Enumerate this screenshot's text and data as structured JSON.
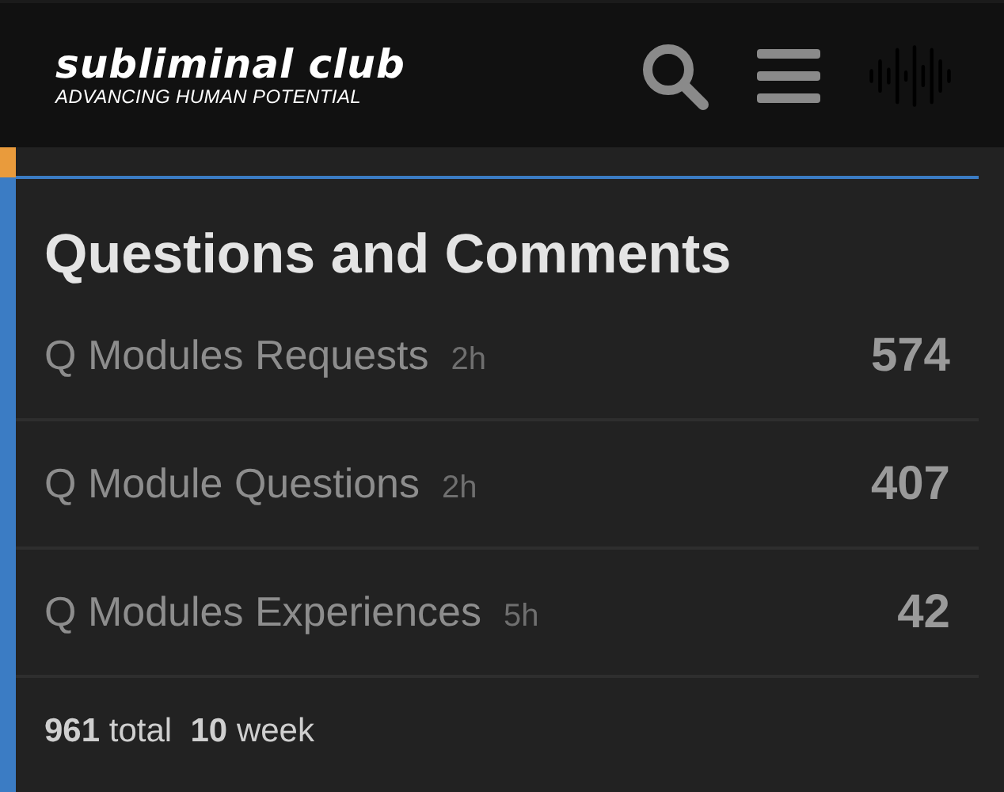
{
  "header": {
    "logo_title": "subliminal club",
    "logo_tagline": "ADVANCING HUMAN POTENTIAL"
  },
  "category": {
    "title": "Questions and Comments",
    "topics": [
      {
        "title": "Q Modules Requests",
        "age": "2h",
        "count": "574"
      },
      {
        "title": "Q Module Questions",
        "age": "2h",
        "count": "407"
      },
      {
        "title": "Q Modules Experiences",
        "age": "5h",
        "count": "42"
      }
    ],
    "stats": "**961** total  **10** week"
  }
}
